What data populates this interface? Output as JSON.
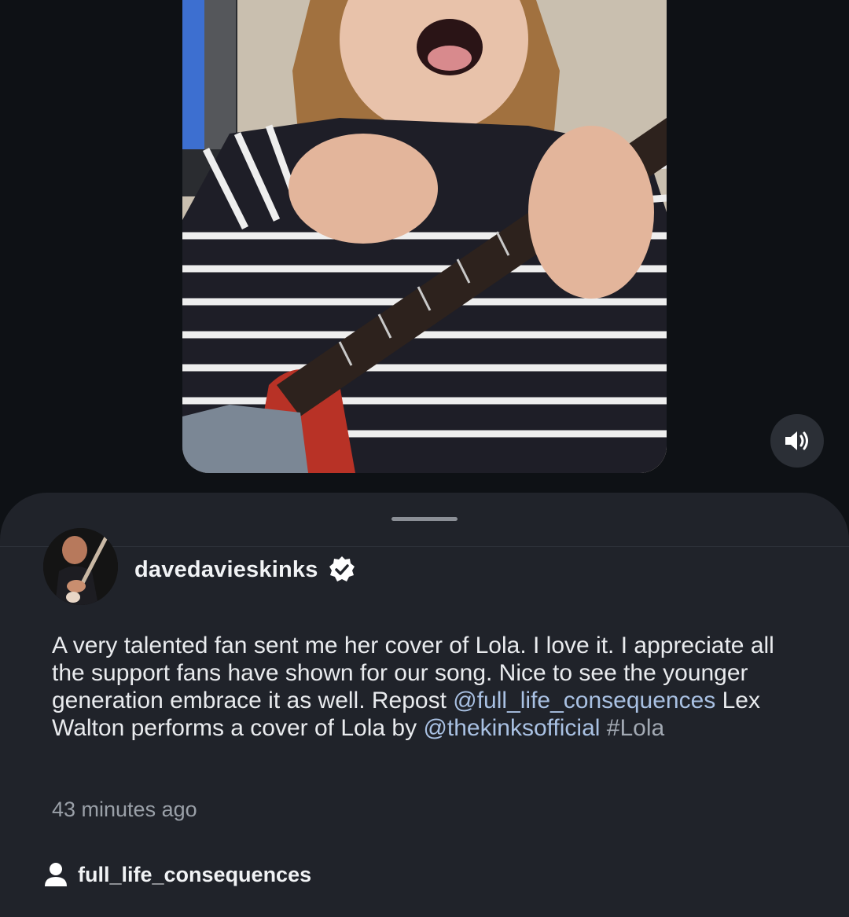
{
  "post": {
    "username": "davedavieskinks",
    "verified": true,
    "caption_text_1": "A very talented fan sent me her cover of Lola. I love it. I appreciate all the support fans have shown for our song. Nice to see the younger generation embrace it as well. Repost ",
    "mention_1": "@full_life_consequences",
    "caption_text_2": " Lex Walton performs a cover of Lola by ",
    "mention_2": "@thekinksofficial",
    "caption_text_3": " ",
    "hashtag": "#Lola",
    "timestamp": "43 minutes ago",
    "source_account": "full_life_consequences"
  },
  "video": {
    "audio_icon": "speaker-icon"
  },
  "colors": {
    "background": "#0e1115",
    "sheet": "#20232a",
    "mention": "#a9c1e3"
  }
}
